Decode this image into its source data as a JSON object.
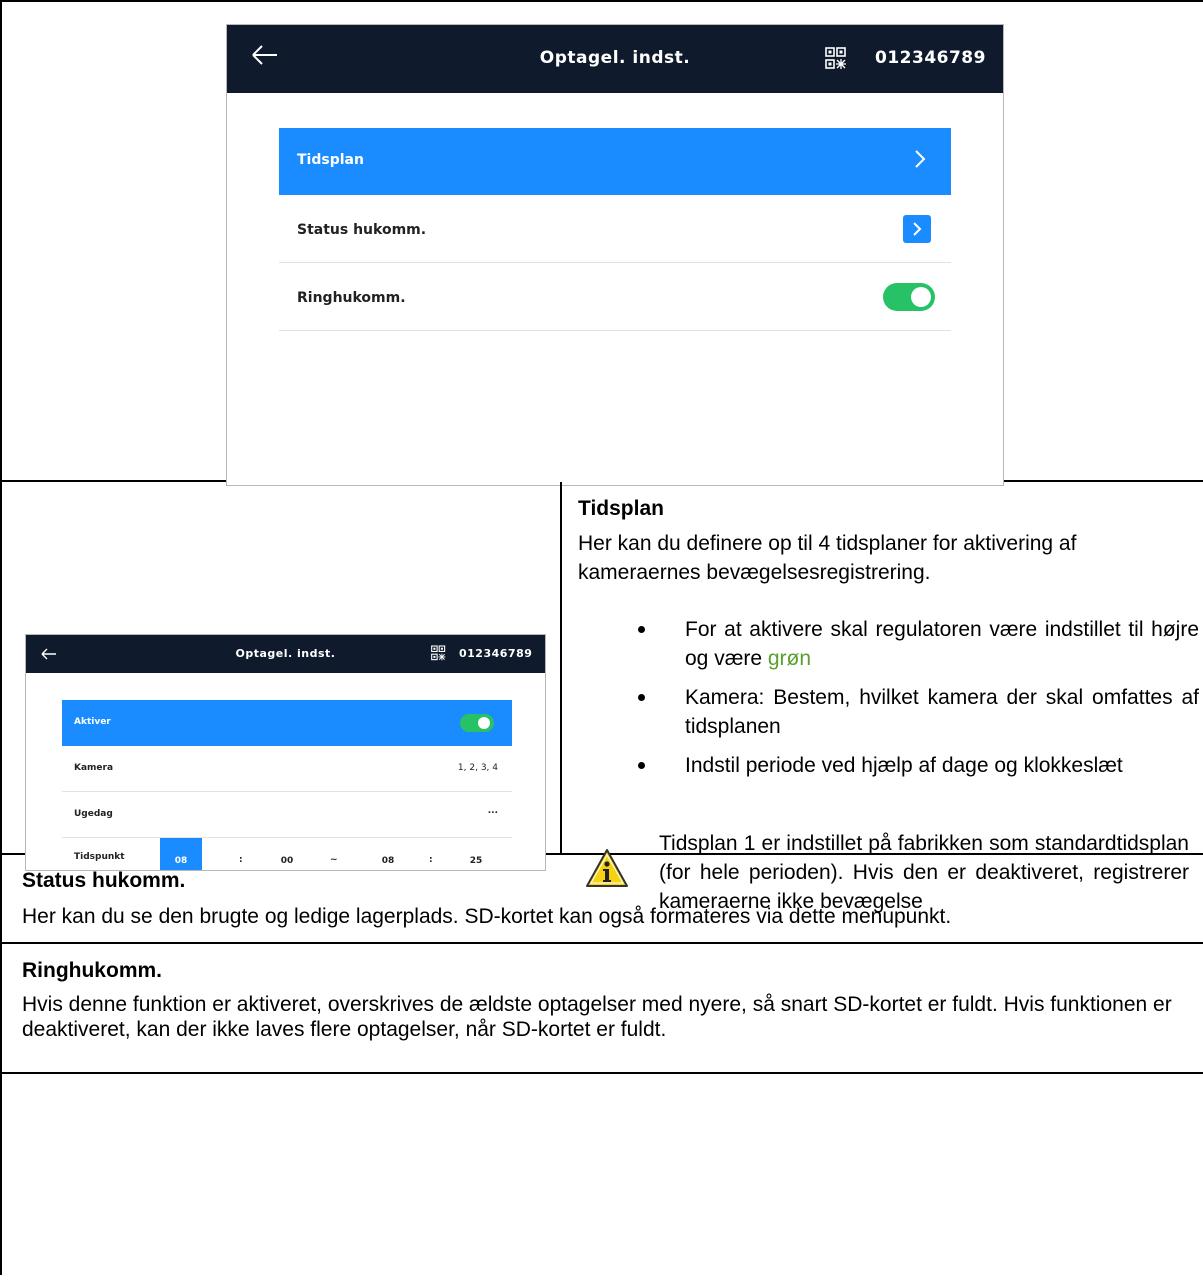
{
  "screen_main": {
    "title": "Optagel. indst.",
    "device_id": "012346789",
    "items": [
      {
        "label": "Tidsplan"
      },
      {
        "label": "Status hukomm."
      },
      {
        "label": "Ringhukomm."
      }
    ]
  },
  "screen_schedule": {
    "title": "Optagel. indst.",
    "device_id": "012346789",
    "rows": {
      "activate": "Aktiver",
      "camera": "Kamera",
      "camera_value": "1, 2, 3, 4",
      "weekday": "Ugedag",
      "weekday_value": "...",
      "time": "Tidspunkt"
    },
    "time_fields": {
      "start_hour": "08",
      "sep1": ":",
      "start_min": "00",
      "tilde": "~",
      "end_hour": "08",
      "sep2": ":",
      "end_min": "25"
    }
  },
  "tidsplan": {
    "heading": "Tidsplan",
    "intro": "Her kan du definere op til 4 tidsplaner for aktivering af kameraernes bevægelsesregistrering.",
    "bullet1_prefix": "For at aktivere skal regulatoren være indstillet til højre og være ",
    "bullet1_green": "grøn",
    "bullet2": "Kamera: Bestem, hvilket kamera der skal omfattes af tidsplanen",
    "bullet3": "Indstil periode ved hjælp af dage og klokkeslæt",
    "note": "Tidsplan 1 er indstillet på fabrikken som standardtidsplan (for hele perioden). Hvis den er deaktiveret, registrerer kameraerne ikke bevægelse"
  },
  "status": {
    "heading": "Status hukomm.",
    "text": "Her kan du se den brugte og ledige lagerplads. SD-kortet kan også formateres via dette menupunkt."
  },
  "ring": {
    "heading": "Ringhukomm.",
    "text": "Hvis denne funktion er aktiveret, overskrives de ældste optagelser med nyere, så snart SD-kortet er fuldt. Hvis funktionen er deaktiveret, kan der ikke laves flere optagelser, når SD-kortet er fuldt."
  },
  "colors": {
    "topbar": "#0f1b2d",
    "accent_blue": "#1a8cff",
    "toggle_green": "#27c266",
    "text_green": "#5aa02c",
    "warning_yellow": "#f5d313"
  },
  "icons": [
    "back-arrow-icon",
    "qr-code-icon",
    "chevron-right-icon",
    "toggle-switch",
    "info-warning-icon"
  ]
}
